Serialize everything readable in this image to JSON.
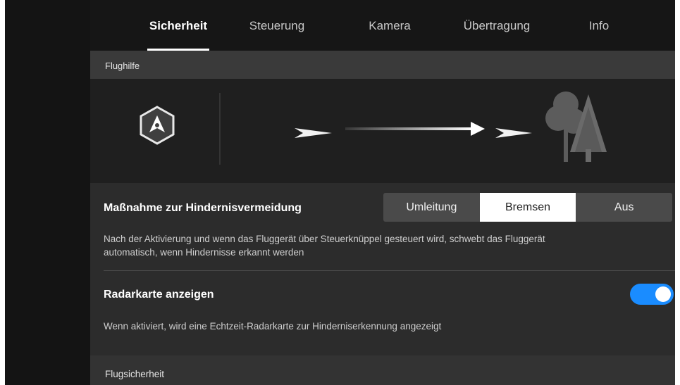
{
  "tabs": [
    {
      "label": "Sicherheit",
      "active": true
    },
    {
      "label": "Steuerung",
      "active": false
    },
    {
      "label": "Kamera",
      "active": false
    },
    {
      "label": "Übertragung",
      "active": false
    },
    {
      "label": "Info",
      "active": false
    }
  ],
  "section": {
    "title": "Flughilfe"
  },
  "illustration": {
    "icons": [
      "aircraft-logo-icon",
      "paper-plane-icon",
      "arrow-right-icon",
      "paper-plane-icon",
      "trees-icon"
    ]
  },
  "obstacle_avoidance": {
    "title": "Maßnahme zur Hindernisvermeidung",
    "options": [
      "Umleitung",
      "Bremsen",
      "Aus"
    ],
    "selected": "Bremsen",
    "description_line1": "Nach der Aktivierung und wenn das Fluggerät über Steuerknüppel gesteuert wird, schwebt das Fluggerät",
    "description_line2": "automatisch, wenn Hindernisse erkannt werden"
  },
  "radar": {
    "title": "Radarkarte anzeigen",
    "enabled": true,
    "description": "Wenn aktiviert, wird eine Echtzeit-Radarkarte zur Hinderniserkennung angezeigt"
  },
  "next_section": {
    "title": "Flugsicherheit"
  },
  "colors": {
    "accent": "#1a8cff",
    "panel": "#2c2c2c",
    "tabbar": "#161616"
  }
}
